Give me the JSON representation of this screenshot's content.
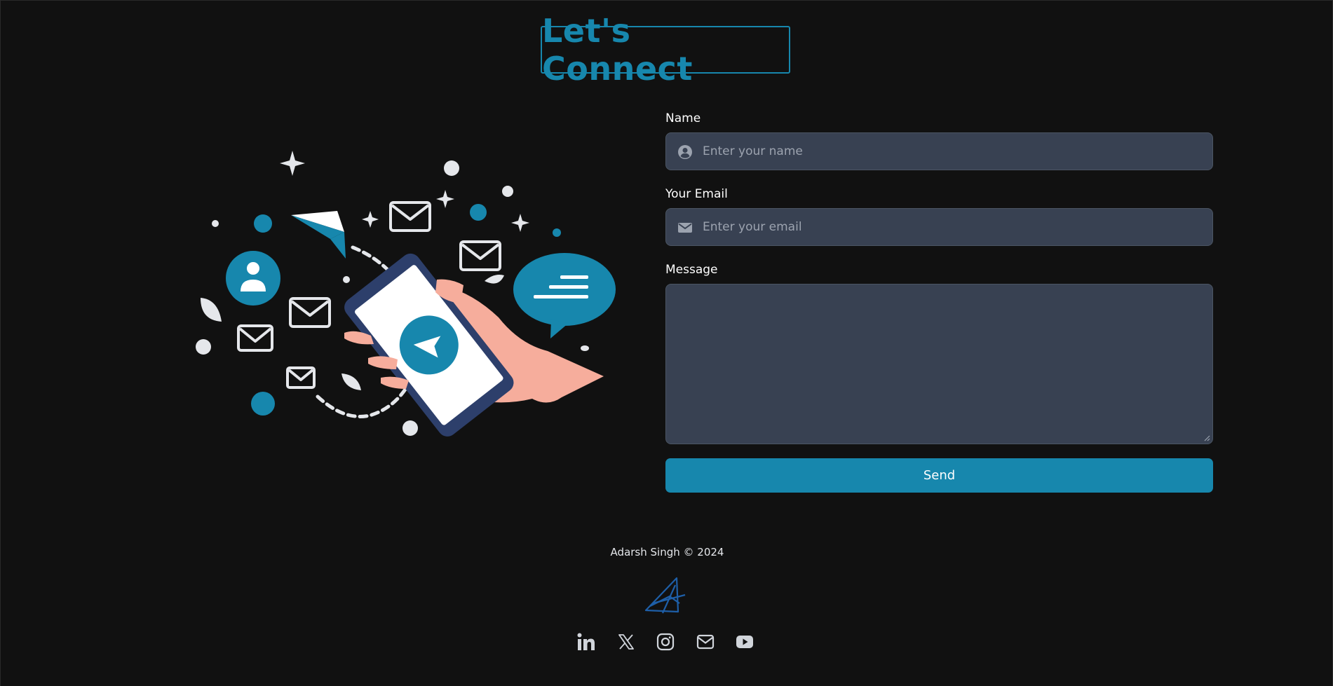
{
  "header": {
    "title": "Let's Connect"
  },
  "form": {
    "name": {
      "label": "Name",
      "placeholder": "Enter your name",
      "value": ""
    },
    "email": {
      "label": "Your Email",
      "placeholder": "Enter your email",
      "value": ""
    },
    "message": {
      "label": "Message",
      "value": ""
    },
    "submit_label": "Send"
  },
  "footer": {
    "copyright": "Adarsh Singh © 2024",
    "socials": [
      {
        "icon": "linkedin-icon"
      },
      {
        "icon": "x-twitter-icon"
      },
      {
        "icon": "instagram-icon"
      },
      {
        "icon": "mail-icon"
      },
      {
        "icon": "youtube-icon"
      }
    ]
  },
  "colors": {
    "accent": "#1787ad",
    "background": "#111111",
    "input_bg": "#384152",
    "skin": "#f6ad9c",
    "phone": "#2d3f6b"
  }
}
